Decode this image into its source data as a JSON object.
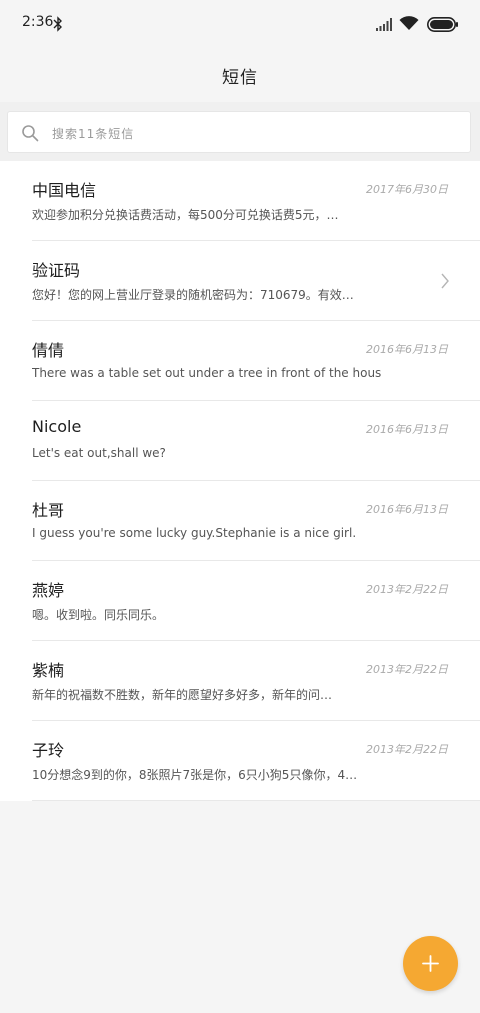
{
  "status_bar": {
    "time": "2:36"
  },
  "header": {
    "title": "短信"
  },
  "search": {
    "placeholder": "搜索11条短信"
  },
  "messages": [
    {
      "name": "中国电信",
      "date": "2017年6月30日",
      "preview": "欢迎参加积分兑换话费活动，每500分可兑换话费5元，…",
      "chevron": false
    },
    {
      "name": "验证码",
      "date": "",
      "preview": "您好！您的网上营业厅登录的随机密码为：710679。有效…",
      "chevron": true
    },
    {
      "name": "倩倩",
      "date": "2016年6月13日",
      "preview": "There was a table set out under a tree in front of the hous",
      "chevron": false
    },
    {
      "name": "Nicole",
      "date": "2016年6月13日",
      "preview": "Let's eat out,shall we?",
      "chevron": false
    },
    {
      "name": "杜哥",
      "date": "2016年6月13日",
      "preview": "I guess you're some lucky guy.Stephanie is a nice girl.",
      "chevron": false
    },
    {
      "name": "燕婷",
      "date": "2013年2月22日",
      "preview": "嗯。收到啦。同乐同乐。",
      "chevron": false
    },
    {
      "name": "紫楠",
      "date": "2013年2月22日",
      "preview": "新年的祝福数不胜数，新年的愿望好多好多，新年的问…",
      "chevron": false
    },
    {
      "name": "子玲",
      "date": "2013年2月22日",
      "preview": "10分想念9到的你，8张照片7张是你，6只小狗5只像你，4…",
      "chevron": false
    }
  ],
  "colors": {
    "accent": "#f5a832",
    "background": "#f5f5f5",
    "list_background": "#ffffff"
  },
  "icons": {
    "status": [
      "bluetooth-icon",
      "signal-icon",
      "wifi-icon",
      "battery-icon"
    ],
    "search": "search-icon",
    "fab": "plus-icon"
  }
}
